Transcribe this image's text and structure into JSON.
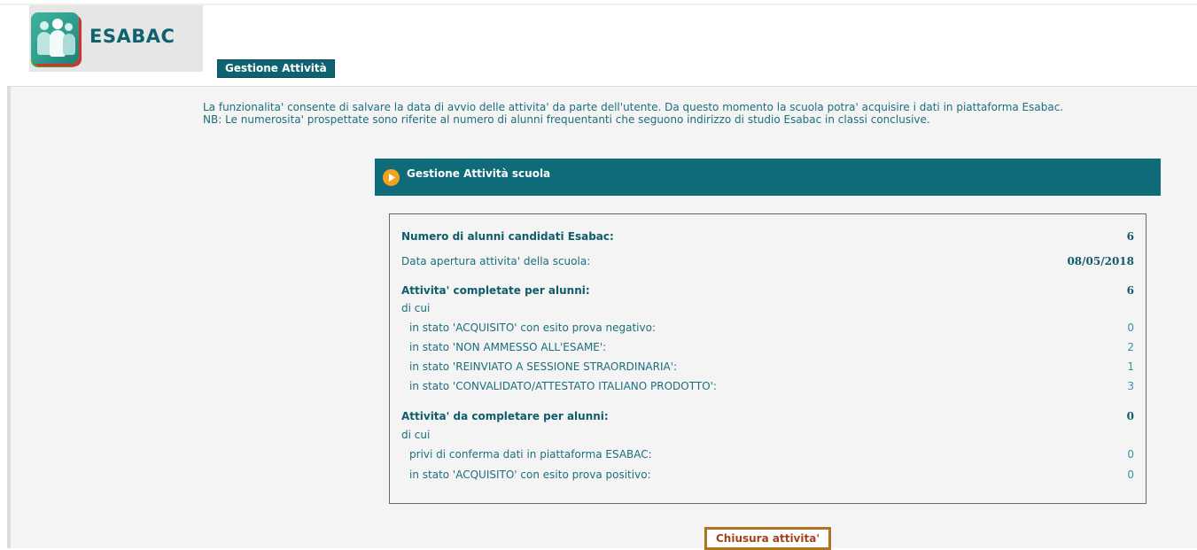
{
  "header": {
    "app_name": "ESABAC",
    "tab_label": "Gestione Attività"
  },
  "intro": {
    "line1": "La funzionalita' consente di salvare la data di avvio delle attivita' da parte dell'utente. Da questo momento la scuola potra' acquisire i dati in piattaforma Esabac.",
    "line2": "NB: Le numerosita' prospettate sono riferite al numero di alunni frequentanti che seguono indirizzo di studio Esabac in classi conclusive."
  },
  "panel": {
    "title": "Gestione Attività scuola"
  },
  "summary": {
    "candidates": {
      "label": "Numero di alunni candidati Esabac:",
      "value": "6"
    },
    "opening_date": {
      "label": "Data apertura attivita' della scuola:",
      "value": "08/05/2018"
    },
    "completed": {
      "label": "Attivita' completate per alunni:",
      "value": "6"
    },
    "completed_of_which": "di cui",
    "completed_items": [
      {
        "label": "in stato 'ACQUISITO' con esito prova negativo:",
        "value": "0"
      },
      {
        "label": "in stato 'NON AMMESSO ALL'ESAME':",
        "value": "2"
      },
      {
        "label": "in stato 'REINVIATO A SESSIONE STRAORDINARIA':",
        "value": "1"
      },
      {
        "label": "in stato 'CONVALIDATO/ATTESTATO ITALIANO PRODOTTO':",
        "value": "3"
      }
    ],
    "to_complete": {
      "label": "Attivita' da completare per alunni:",
      "value": "0"
    },
    "to_complete_of_which": "di cui",
    "to_complete_items": [
      {
        "label": "privi di conferma dati in piattaforma ESABAC:",
        "value": "0"
      },
      {
        "label": "in stato 'ACQUISITO' con esito prova positivo:",
        "value": "0"
      }
    ]
  },
  "actions": {
    "close_label": "Chiusura attivita'"
  },
  "colors": {
    "primary": "#0f6b7a",
    "accent_orange": "#f4a21c",
    "button_border": "#b0731f",
    "button_text": "#a6401d"
  },
  "icons": {
    "logo": "esabac-people-logo",
    "panel": "play-circle-icon"
  }
}
